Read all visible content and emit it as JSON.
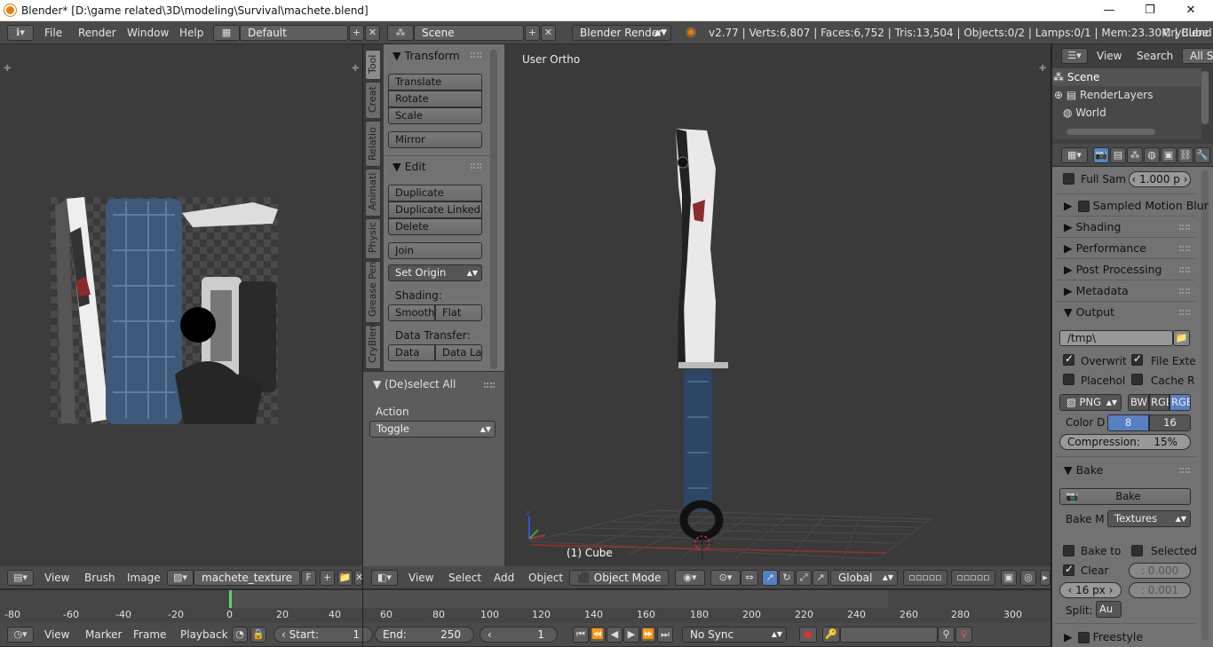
{
  "window": {
    "title": "Blender* [D:\\game related\\3D\\modeling\\Survival\\machete.blend]",
    "minimize": "—",
    "maximize": "❐",
    "close": "✕"
  },
  "info_header": {
    "menus": [
      "File",
      "Render",
      "Window",
      "Help"
    ],
    "screen_layout": "Default",
    "scene": "Scene",
    "render_engine": "Blender Render",
    "stats": "v2.77 | Verts:6,807 | Faces:6,752 | Tris:13,504 | Objects:0/2 | Lamps:0/1 | Mem:23.30M | Cube",
    "addon_label": "CryBlend"
  },
  "image_editor": {
    "menus": [
      "View",
      "Brush",
      "Image"
    ],
    "image_name": "machete_texture",
    "fake_user": "F"
  },
  "toolshelf": {
    "tabs": [
      "Tool",
      "Creat",
      "Relatio",
      "Animati",
      "Physic",
      "Grease Pen",
      "CryBlen"
    ],
    "transform": {
      "title": "Transform",
      "buttons": [
        "Translate",
        "Rotate",
        "Scale",
        "Mirror"
      ]
    },
    "edit": {
      "title": "Edit",
      "buttons": [
        "Duplicate",
        "Duplicate Linked",
        "Delete",
        "Join"
      ],
      "set_origin": "Set Origin",
      "shading_label": "Shading:",
      "shading": [
        "Smooth",
        "Flat"
      ],
      "data_transfer_label": "Data Transfer:",
      "data_transfer": [
        "Data",
        "Data La"
      ]
    },
    "operator": {
      "title": "(De)select All",
      "action_label": "Action",
      "action_value": "Toggle"
    }
  },
  "viewport": {
    "view_label": "User Ortho",
    "object_label": "(1) Cube",
    "menus": [
      "View",
      "Select",
      "Add",
      "Object"
    ],
    "mode": "Object Mode",
    "orientation": "Global"
  },
  "outliner": {
    "menus": [
      "View",
      "Search"
    ],
    "filter": "All Sc",
    "items": [
      "Scene",
      "RenderLayers",
      "World"
    ]
  },
  "properties": {
    "full_sample": "Full Sam",
    "full_sample_value": "1.000 p",
    "sections": [
      "Sampled Motion Blur",
      "Shading",
      "Performance",
      "Post Processing",
      "Metadata"
    ],
    "output": {
      "title": "Output",
      "path": "/tmp\\",
      "overwrite": "Overwrit",
      "file_ext": "File Exte",
      "placeholder": "Placehol",
      "cache": "Cache R",
      "format": "PNG",
      "color_modes": [
        "BW",
        "RGB",
        "RGB"
      ],
      "color_depth_label": "Color D",
      "color_depths": [
        "8",
        "16"
      ],
      "compression_label": "Compression:",
      "compression_value": "15%"
    },
    "bake": {
      "title": "Bake",
      "bake_button": "Bake",
      "mode_label": "Bake M",
      "mode_value": "Textures",
      "bake_to": "Bake to",
      "selected": "Selected",
      "clear": "Clear",
      "margin": "16 px",
      "dist": ": 0.000",
      "bias": ": 0.001",
      "split_label": "Split:",
      "split_value": "Au"
    },
    "freestyle": "Freestyle"
  },
  "timeline": {
    "ticks": [
      "-80",
      "-60",
      "-40",
      "-20",
      "0",
      "20",
      "40",
      "60",
      "80",
      "100",
      "120",
      "140",
      "160",
      "180",
      "200",
      "220",
      "240",
      "260",
      "280",
      "300"
    ],
    "menus": [
      "View",
      "Marker",
      "Frame",
      "Playback"
    ],
    "start_label": "Start:",
    "start_value": "1",
    "end_label": "End:",
    "end_value": "250",
    "current": "1",
    "sync": "No Sync"
  }
}
